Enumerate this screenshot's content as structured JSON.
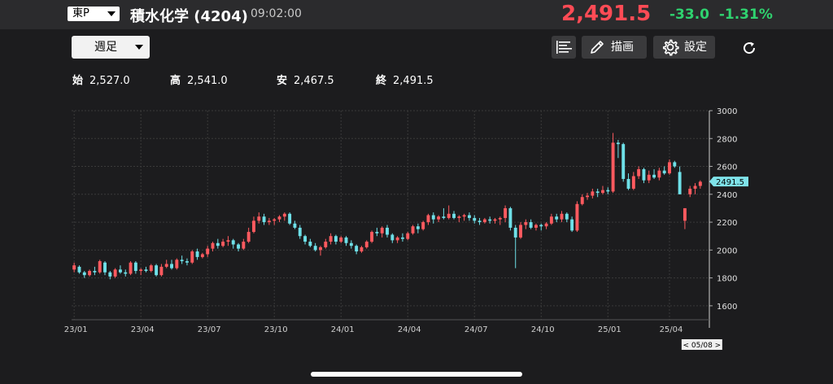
{
  "header": {
    "market": "東P",
    "stock_name": "積水化学 (4204)",
    "time": "09:02:00",
    "price": "2,491.5",
    "change": "-33.0",
    "change_pct": "-1.31%"
  },
  "toolbar": {
    "period": "週足",
    "draw_label": "描画",
    "settings_label": "設定",
    "icons": {
      "indicator": "bar-list-icon",
      "draw": "pencil-icon",
      "settings": "gear-icon",
      "refresh": "refresh-icon"
    }
  },
  "ohlc": {
    "open_label": "始",
    "open": "2,527.0",
    "high_label": "高",
    "high": "2,541.0",
    "low_label": "安",
    "low": "2,467.5",
    "close_label": "終",
    "close": "2,491.5"
  },
  "chart_data": {
    "type": "candlestick",
    "ylim": [
      1500,
      3000
    ],
    "y_ticks": [
      1600,
      1800,
      2000,
      2200,
      2400,
      2600,
      2800,
      3000
    ],
    "x_ticks": [
      "23/01",
      "23/04",
      "23/07",
      "23/10",
      "24/01",
      "24/04",
      "24/07",
      "24/10",
      "25/01",
      "25/04"
    ],
    "last_price_label": "2491.5",
    "cursor_label": "< 05/08 >",
    "grid": true,
    "colors": {
      "up": "#ff5a5f",
      "down": "#6ee0e8"
    },
    "candles": [
      [
        1860,
        1910,
        1840,
        1890
      ],
      [
        1880,
        1890,
        1830,
        1840
      ],
      [
        1840,
        1850,
        1800,
        1820
      ],
      [
        1820,
        1860,
        1810,
        1850
      ],
      [
        1850,
        1880,
        1820,
        1840
      ],
      [
        1840,
        1930,
        1830,
        1920
      ],
      [
        1910,
        1920,
        1820,
        1840
      ],
      [
        1840,
        1850,
        1790,
        1810
      ],
      [
        1810,
        1870,
        1800,
        1860
      ],
      [
        1860,
        1890,
        1830,
        1840
      ],
      [
        1840,
        1860,
        1810,
        1830
      ],
      [
        1830,
        1920,
        1820,
        1910
      ],
      [
        1910,
        1920,
        1830,
        1850
      ],
      [
        1850,
        1870,
        1820,
        1860
      ],
      [
        1860,
        1880,
        1840,
        1850
      ],
      [
        1850,
        1900,
        1840,
        1890
      ],
      [
        1890,
        1900,
        1810,
        1820
      ],
      [
        1820,
        1900,
        1810,
        1880
      ],
      [
        1880,
        1930,
        1870,
        1900
      ],
      [
        1900,
        1930,
        1860,
        1870
      ],
      [
        1870,
        1940,
        1860,
        1930
      ],
      [
        1930,
        1960,
        1900,
        1920
      ],
      [
        1920,
        1940,
        1890,
        1910
      ],
      [
        1910,
        2000,
        1900,
        1990
      ],
      [
        1990,
        2010,
        1930,
        1950
      ],
      [
        1950,
        1980,
        1940,
        1970
      ],
      [
        1970,
        2030,
        1950,
        2010
      ],
      [
        2010,
        2060,
        1990,
        2050
      ],
      [
        2050,
        2080,
        2010,
        2030
      ],
      [
        2030,
        2080,
        2020,
        2060
      ],
      [
        2060,
        2100,
        2030,
        2070
      ],
      [
        2070,
        2080,
        2010,
        2040
      ],
      [
        2040,
        2050,
        1990,
        2010
      ],
      [
        2010,
        2080,
        2000,
        2060
      ],
      [
        2060,
        2160,
        2050,
        2130
      ],
      [
        2130,
        2240,
        2120,
        2210
      ],
      [
        2210,
        2270,
        2190,
        2240
      ],
      [
        2240,
        2260,
        2180,
        2200
      ],
      [
        2200,
        2230,
        2180,
        2210
      ],
      [
        2210,
        2230,
        2180,
        2220
      ],
      [
        2220,
        2250,
        2200,
        2240
      ],
      [
        2240,
        2270,
        2210,
        2260
      ],
      [
        2260,
        2270,
        2180,
        2190
      ],
      [
        2190,
        2210,
        2150,
        2160
      ],
      [
        2160,
        2180,
        2080,
        2100
      ],
      [
        2100,
        2110,
        2040,
        2060
      ],
      [
        2060,
        2080,
        2020,
        2030
      ],
      [
        2030,
        2050,
        1990,
        2000
      ],
      [
        2000,
        2030,
        1960,
        2020
      ],
      [
        2020,
        2080,
        2010,
        2060
      ],
      [
        2060,
        2120,
        2040,
        2100
      ],
      [
        2100,
        2110,
        2040,
        2060
      ],
      [
        2060,
        2100,
        2050,
        2090
      ],
      [
        2090,
        2100,
        2030,
        2050
      ],
      [
        2050,
        2070,
        2010,
        2030
      ],
      [
        2030,
        2040,
        1970,
        1990
      ],
      [
        1990,
        2030,
        1980,
        2020
      ],
      [
        2020,
        2070,
        2010,
        2060
      ],
      [
        2060,
        2140,
        2050,
        2130
      ],
      [
        2130,
        2160,
        2100,
        2120
      ],
      [
        2120,
        2170,
        2090,
        2160
      ],
      [
        2160,
        2180,
        2090,
        2110
      ],
      [
        2110,
        2120,
        2050,
        2070
      ],
      [
        2070,
        2100,
        2050,
        2090
      ],
      [
        2090,
        2120,
        2060,
        2080
      ],
      [
        2080,
        2130,
        2070,
        2120
      ],
      [
        2120,
        2180,
        2110,
        2170
      ],
      [
        2170,
        2190,
        2120,
        2150
      ],
      [
        2150,
        2210,
        2140,
        2200
      ],
      [
        2200,
        2260,
        2180,
        2250
      ],
      [
        2250,
        2270,
        2190,
        2220
      ],
      [
        2220,
        2250,
        2200,
        2240
      ],
      [
        2240,
        2300,
        2220,
        2230
      ],
      [
        2230,
        2320,
        2220,
        2260
      ],
      [
        2260,
        2280,
        2220,
        2230
      ],
      [
        2230,
        2250,
        2200,
        2240
      ],
      [
        2240,
        2260,
        2210,
        2250
      ],
      [
        2250,
        2270,
        2210,
        2230
      ],
      [
        2230,
        2250,
        2190,
        2210
      ],
      [
        2210,
        2230,
        2180,
        2200
      ],
      [
        2200,
        2230,
        2190,
        2220
      ],
      [
        2220,
        2240,
        2190,
        2210
      ],
      [
        2210,
        2230,
        2190,
        2220
      ],
      [
        2220,
        2240,
        2180,
        2230
      ],
      [
        2230,
        2320,
        2200,
        2300
      ],
      [
        2300,
        2310,
        2140,
        2160
      ],
      [
        2160,
        2180,
        1870,
        2090
      ],
      [
        2090,
        2200,
        2080,
        2180
      ],
      [
        2180,
        2220,
        2150,
        2200
      ],
      [
        2200,
        2220,
        2150,
        2160
      ],
      [
        2160,
        2190,
        2140,
        2180
      ],
      [
        2180,
        2190,
        2140,
        2170
      ],
      [
        2170,
        2200,
        2150,
        2190
      ],
      [
        2190,
        2260,
        2180,
        2240
      ],
      [
        2240,
        2260,
        2200,
        2220
      ],
      [
        2220,
        2280,
        2200,
        2260
      ],
      [
        2260,
        2270,
        2200,
        2220
      ],
      [
        2220,
        2240,
        2130,
        2140
      ],
      [
        2140,
        2350,
        2130,
        2330
      ],
      [
        2330,
        2400,
        2320,
        2380
      ],
      [
        2380,
        2410,
        2360,
        2390
      ],
      [
        2390,
        2440,
        2370,
        2420
      ],
      [
        2420,
        2440,
        2380,
        2410
      ],
      [
        2410,
        2460,
        2400,
        2430
      ],
      [
        2430,
        2450,
        2400,
        2420
      ],
      [
        2420,
        2840,
        2410,
        2770
      ],
      [
        2770,
        2790,
        2660,
        2760
      ],
      [
        2760,
        2770,
        2490,
        2510
      ],
      [
        2510,
        2550,
        2430,
        2440
      ],
      [
        2440,
        2560,
        2430,
        2530
      ],
      [
        2530,
        2600,
        2510,
        2580
      ],
      [
        2580,
        2590,
        2480,
        2500
      ],
      [
        2500,
        2570,
        2480,
        2540
      ],
      [
        2540,
        2580,
        2510,
        2520
      ],
      [
        2520,
        2590,
        2500,
        2570
      ],
      [
        2570,
        2600,
        2540,
        2550
      ],
      [
        2550,
        2650,
        2540,
        2630
      ],
      [
        2630,
        2640,
        2590,
        2600
      ],
      [
        2560,
        2600,
        2400,
        2400
      ],
      [
        2210,
        2300,
        2150,
        2300
      ],
      [
        2400,
        2460,
        2380,
        2440
      ],
      [
        2440,
        2480,
        2400,
        2460
      ],
      [
        2460,
        2500,
        2440,
        2490
      ]
    ]
  }
}
